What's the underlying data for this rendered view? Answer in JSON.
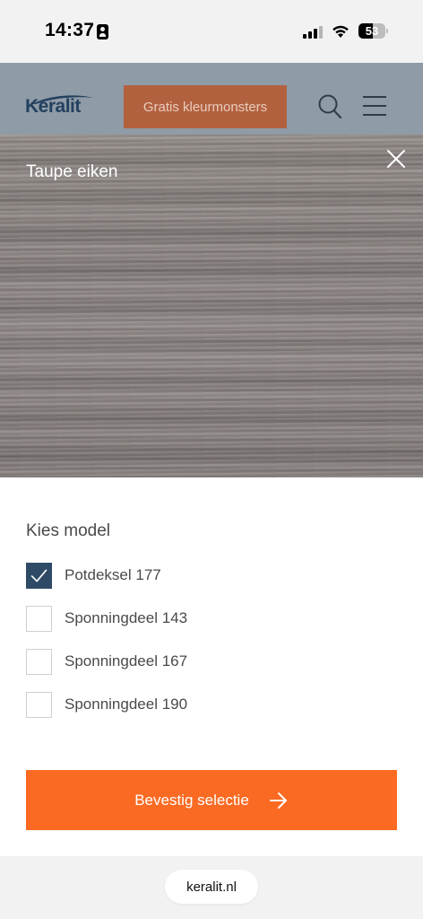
{
  "status_bar": {
    "time": "14:37",
    "battery": "53",
    "battery_level": 0.53
  },
  "header": {
    "logo_text": "Keralit",
    "cta_label": "Gratis kleurmonsters",
    "icons": {
      "search": "search-icon",
      "menu": "hamburger-menu-icon"
    },
    "colors": {
      "header_bg": "#8f9ba6",
      "cta_bg": "#b2613f",
      "logo": "#23405f"
    }
  },
  "swatch": {
    "title": "Taupe eiken",
    "close_icon": "close-icon"
  },
  "panel": {
    "title": "Kies model",
    "options": [
      {
        "label": "Potdeksel 177",
        "checked": true
      },
      {
        "label": "Sponningdeel 143",
        "checked": false
      },
      {
        "label": "Sponningdeel 167",
        "checked": false
      },
      {
        "label": "Sponningdeel 190",
        "checked": false
      }
    ],
    "confirm_label": "Bevestig selectie",
    "confirm_icon": "arrow-right-icon",
    "colors": {
      "checkbox_checked": "#2f4a66",
      "confirm_bg": "#fb6a22"
    }
  },
  "browser": {
    "url": "keralit.nl"
  }
}
